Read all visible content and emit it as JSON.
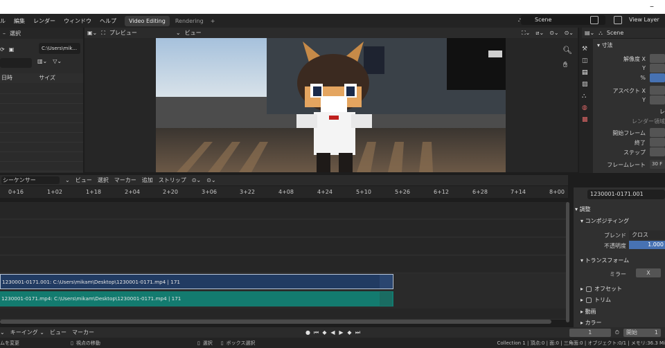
{
  "menubar": {
    "items": [
      "ル",
      "編集",
      "レンダー",
      "ウィンドウ",
      "ヘルプ"
    ],
    "workspaces": [
      "Video Editing",
      "Rendering"
    ],
    "add_workspace": "+",
    "scene": "Scene",
    "view_layer": "View Layer"
  },
  "file_browser": {
    "menu_label": "選択",
    "path": "C:\\Users\\mik...",
    "col_time": "日時",
    "col_size": "サイズ"
  },
  "preview": {
    "mode": "プレビュー",
    "view_label": "ビュー"
  },
  "properties": {
    "scene_label": "Scene",
    "section": "寸法",
    "res_x": "解像度 X",
    "res_y": "Y",
    "res_pct": "%",
    "aspect_x": "アスペクト X",
    "aspect_y": "Y",
    "render_region": "レ",
    "render_region_crop": "レンダー領域",
    "frame_start": "開始フレーム",
    "frame_end": "終了",
    "frame_step": "ステップ",
    "frame_rate": "フレームレート",
    "frame_rate_value": "30 F"
  },
  "sequencer": {
    "editor": "シーケンサー",
    "menus": [
      "ビュー",
      "選択",
      "マーカー",
      "追加",
      "ストリップ"
    ],
    "ruler": [
      "0+16",
      "1+02",
      "1+18",
      "2+04",
      "2+20",
      "3+06",
      "3+22",
      "4+08",
      "4+24",
      "5+10",
      "5+26",
      "6+12",
      "6+28",
      "7+14",
      "8+00"
    ],
    "strips": [
      "1230001-0171.001: C:\\Users\\mikam\\Desktop\\1230001-0171.mp4 | 171",
      "1230001-0171.mp4: C:\\Users\\mikam\\Desktop\\1230001-0171.mp4 | 171"
    ]
  },
  "strip_panel": {
    "name": "1230001-0171.001",
    "adjust": "調整",
    "compositing": "コンポジティング",
    "blend_label": "ブレンド",
    "blend_value": "クロス",
    "opacity_label": "不透明度",
    "opacity_value": "1.000",
    "transform": "トランスフォーム",
    "mirror_label": "ミラー",
    "mirror_x": "X",
    "offset": "オフセット",
    "crop": "トリム",
    "video": "動画",
    "color": "カラー"
  },
  "timeline": {
    "keying": "キーイング",
    "view": "ビュー",
    "marker": "マーカー",
    "current_frame": "1",
    "start_label": "開始",
    "start_value": "1"
  },
  "statusbar": {
    "left": "ムを変更",
    "move_view": "視点の移動",
    "select": "選択",
    "box_select": "ボックス選択",
    "stats": "Collection 1 | 頂点:0 | 面:0 | 三角面:0 | オブジェクト:0/1 | メモリ:36.3 Mi"
  },
  "colors": {
    "accent_blue": "#4772b3",
    "strip_meta": "#213b62",
    "strip_movie": "#137b6f"
  }
}
